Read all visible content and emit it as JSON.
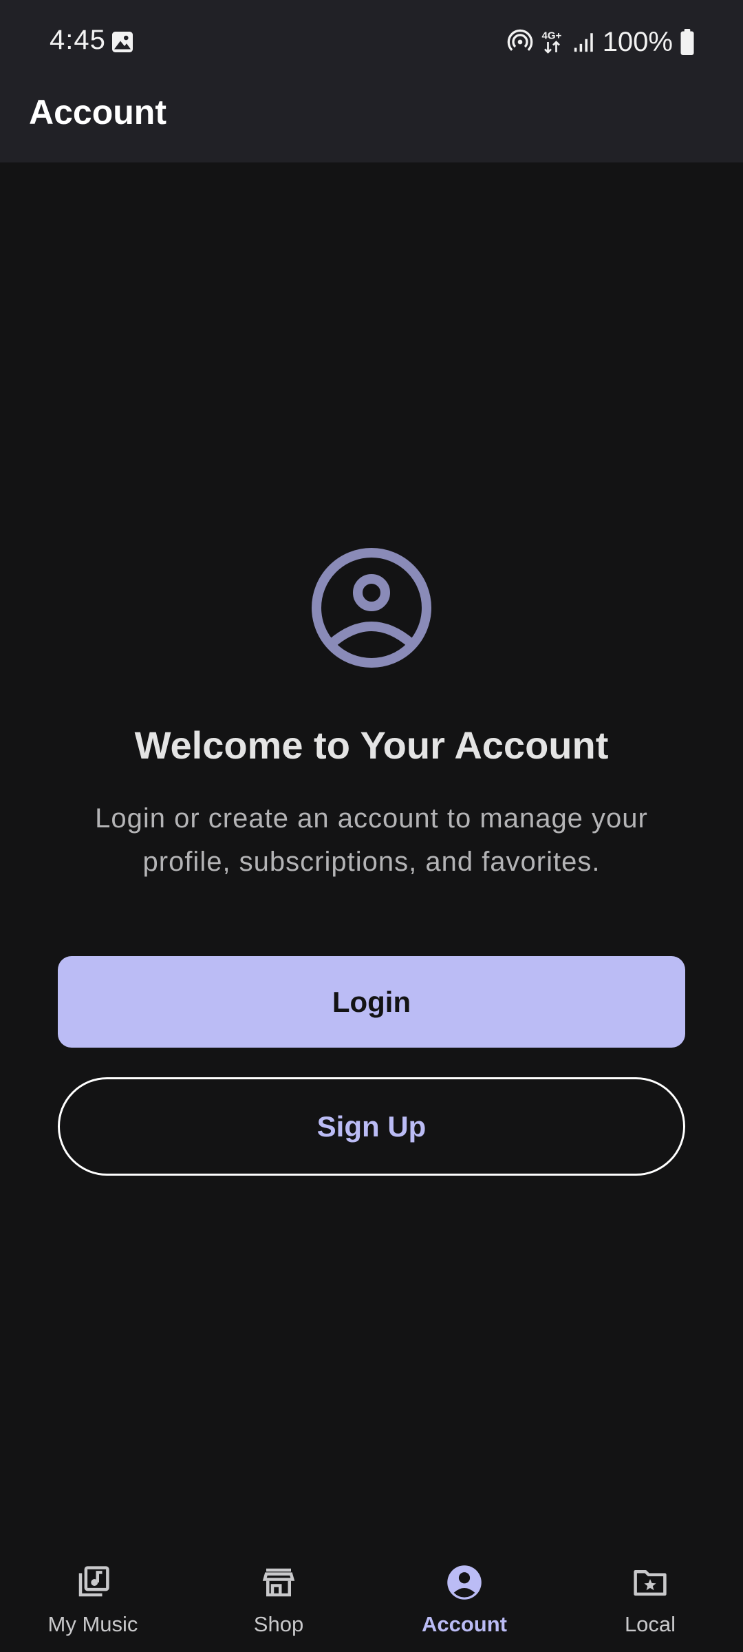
{
  "status_bar": {
    "time": "4:45",
    "battery_text": "100%",
    "network_text": "4G+",
    "icons": [
      "gallery-icon",
      "hotspot-icon",
      "network-4g-icon",
      "signal-icon",
      "battery-icon"
    ]
  },
  "app_bar": {
    "title": "Account"
  },
  "main": {
    "avatar_icon": "account-circle-icon",
    "title": "Welcome to Your Account",
    "subtitle_line1": "Login or create an account to manage your",
    "subtitle_line2": "profile, subscriptions, and favorites.",
    "login_label": "Login",
    "signup_label": "Sign Up"
  },
  "bottom_nav": {
    "items": [
      {
        "label": "My Music",
        "icon": "music-library-icon",
        "active": false
      },
      {
        "label": "Shop",
        "icon": "store-icon",
        "active": false
      },
      {
        "label": "Account",
        "icon": "account-circle-icon",
        "active": true
      },
      {
        "label": "Local",
        "icon": "folder-star-icon",
        "active": false
      }
    ]
  },
  "colors": {
    "background": "#131314",
    "bar_background": "#212126",
    "accent": "#bbbcf5",
    "avatar": "#8a8bb8",
    "text_primary": "#e4e4e4",
    "text_secondary": "#b4b4b6"
  }
}
